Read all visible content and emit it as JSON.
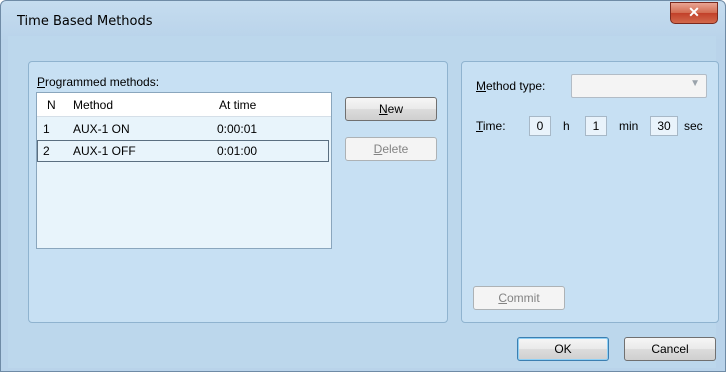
{
  "window": {
    "title": "Time Based Methods",
    "close_glyph": "✕"
  },
  "programmed": {
    "group_label": "Programmed methods:",
    "columns": [
      "N",
      "Method",
      "At time"
    ],
    "rows": [
      {
        "n": "1",
        "method": "AUX-1 ON",
        "time": "0:00:01"
      },
      {
        "n": "2",
        "method": "AUX-1 OFF",
        "time": "0:01:00"
      }
    ],
    "selected_row": 2
  },
  "buttons": {
    "new": "New",
    "delete": "Delete",
    "commit": "Commit",
    "ok": "OK",
    "cancel": "Cancel"
  },
  "method": {
    "type_label": "Method type:",
    "type_value": "",
    "time_label": "Time:",
    "hours": "0",
    "hours_unit": "h",
    "minutes": "1",
    "minutes_unit": "min",
    "seconds": "30",
    "seconds_unit": "sec"
  },
  "colors": {
    "accent": "#b9d3ea",
    "close": "#c2402a"
  }
}
